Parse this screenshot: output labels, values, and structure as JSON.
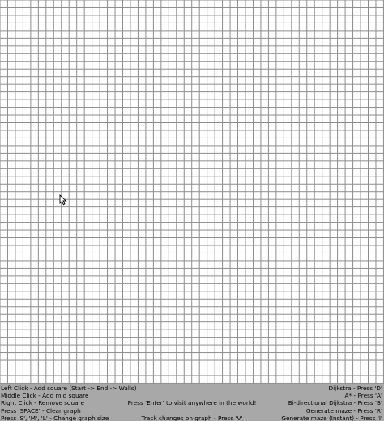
{
  "instructions": {
    "left": [
      "Left Click - Add square (Start -> End -> Walls)",
      "Middle Click - Add mid square",
      "Right Click - Remove square",
      "Press 'SPACE' - Clear graph",
      "Press 'S', 'M', 'L' - Change graph size"
    ],
    "center_top": "Press 'Enter' to visit anywhere in the world!",
    "center_bottom": "Track changes on graph - Press 'V'",
    "right": [
      "Dijkstra - Press 'D'",
      "A* - Press 'A'",
      "Bi-directional Dijkstra - Press 'B'",
      "Generate maze - Press 'R'",
      "Generate maze (Instant) - Press 'I'"
    ]
  },
  "colors": {
    "grid_line": "#8c8c8c",
    "panel_bg": "#a8a8a8",
    "cell_bg": "#ffffff"
  },
  "grid": {
    "columns": 50,
    "rows": 50
  }
}
